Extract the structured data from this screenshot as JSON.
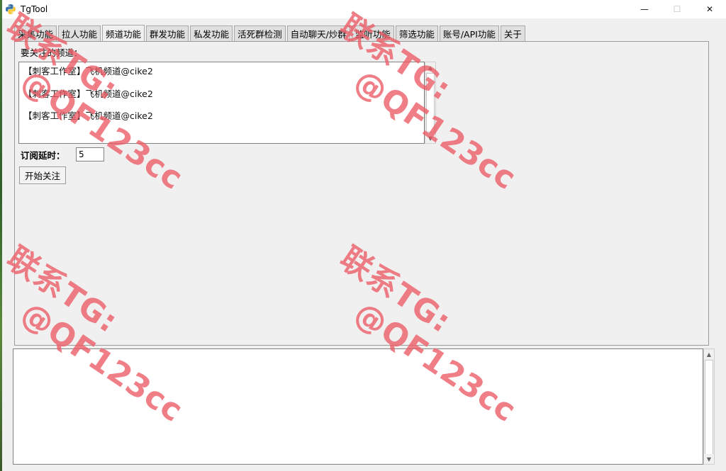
{
  "window": {
    "title": "TgTool",
    "minimize_glyph": "—",
    "maximize_glyph": "☐",
    "close_glyph": "✕"
  },
  "tabs": [
    {
      "label": "采集功能",
      "active": false
    },
    {
      "label": "拉人功能",
      "active": false
    },
    {
      "label": "频道功能",
      "active": true
    },
    {
      "label": "群发功能",
      "active": false
    },
    {
      "label": "私发功能",
      "active": false
    },
    {
      "label": "活死群检测",
      "active": false
    },
    {
      "label": "自动聊天/炒群",
      "active": false
    },
    {
      "label": "监听功能",
      "active": false
    },
    {
      "label": "筛选功能",
      "active": false
    },
    {
      "label": "账号/API功能",
      "active": false
    },
    {
      "label": "关于",
      "active": false
    }
  ],
  "channel_panel": {
    "channels_label": "要关注的频道：",
    "channels": [
      "【刺客工作室】飞机频道@cike2",
      "【刺客工作室】飞机频道@cike2",
      "【刺客工作室】飞机频道@cike2"
    ],
    "delay_label": "订阅延时：",
    "delay_value": "5",
    "start_button": "开始关注"
  },
  "watermark": {
    "line1": "联系TG:",
    "line2": "@QF123cc"
  },
  "colors": {
    "watermark": "#ec5a64",
    "window_bg": "#f0f0f0"
  }
}
